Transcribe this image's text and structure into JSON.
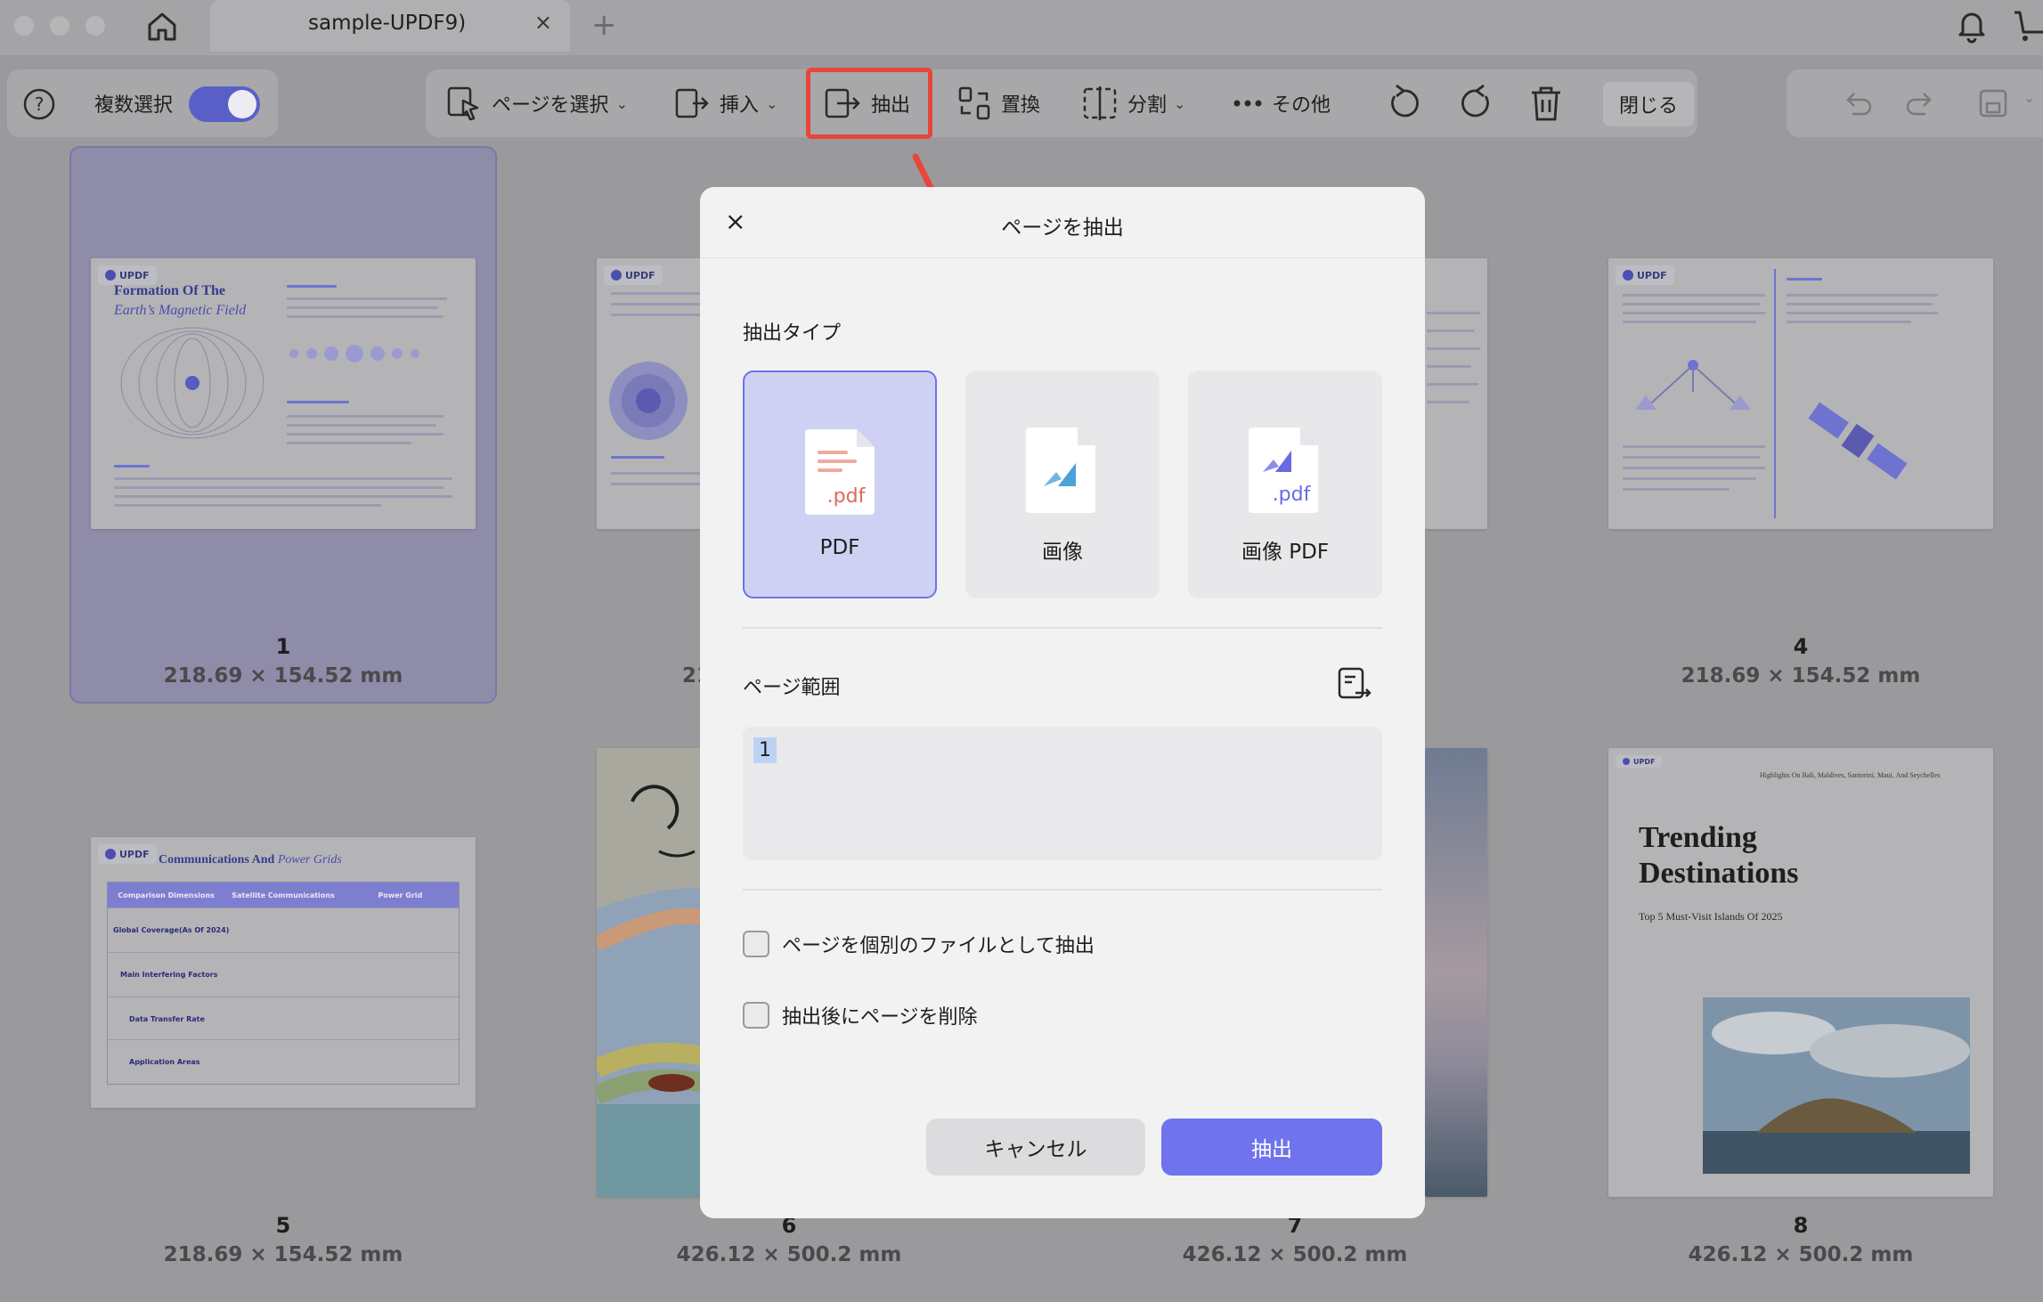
{
  "tab": {
    "title": "sample-UPDF9)",
    "close": "×",
    "new": "+"
  },
  "toolbar": {
    "help": "?",
    "multi_select": "複数選択",
    "select_pages": "ページを選択",
    "insert": "挿入",
    "extract": "抽出",
    "replace": "置換",
    "split": "分割",
    "more": "その他",
    "close": "閉じる",
    "chevron": "⌄"
  },
  "pages": [
    {
      "num": "1",
      "dim": "218.69 × 154.52 mm"
    },
    {
      "num": "4",
      "dim": "218.69 × 154.52 mm"
    },
    {
      "num": "5",
      "dim": "218.69 × 154.52 mm"
    },
    {
      "num": "6",
      "dim": "426.12 × 500.2 mm"
    },
    {
      "num": "7",
      "dim": "426.12 × 500.2 mm"
    },
    {
      "num": "8",
      "dim": "426.12 × 500.2 mm"
    }
  ],
  "thumbs": {
    "p1_title1": "Formation Of The",
    "p1_title2": "Earth’s Magnetic Field",
    "p5_title_a": "Communications And",
    "p5_title_b": "Power Grids",
    "p5_headers": [
      "Comparison Dimensions",
      "Satellite Communications",
      "Power Grid"
    ],
    "p5_rows": [
      "Global Coverage(As Of 2024)",
      "Main Interfering Factors",
      "Data Transfer Rate",
      "Application Areas"
    ],
    "p8_tagline": "Highlights On Bali, Maldives, Santorini, Maui, And Seychelles",
    "p8_title1": "Trending",
    "p8_title2": "Destinations",
    "p8_subtitle": "Top 5 Must-Visit Islands Of 2025",
    "logo": "UPDF",
    "partial_2": "21"
  },
  "dialog": {
    "close": "×",
    "title": "ページを抽出",
    "type_label": "抽出タイプ",
    "types": [
      "PDF",
      "画像",
      "画像 PDF"
    ],
    "file_ext": ".pdf",
    "range_label": "ページ範囲",
    "range_value": "1",
    "opt_separate": "ページを個別のファイルとして抽出",
    "opt_delete": "抽出後にページを削除",
    "cancel": "キャンセル",
    "extract": "抽出"
  },
  "colors": {
    "accent": "#6f73ee",
    "highlight": "#e8453c",
    "selected_card": "#cfd1f2"
  }
}
